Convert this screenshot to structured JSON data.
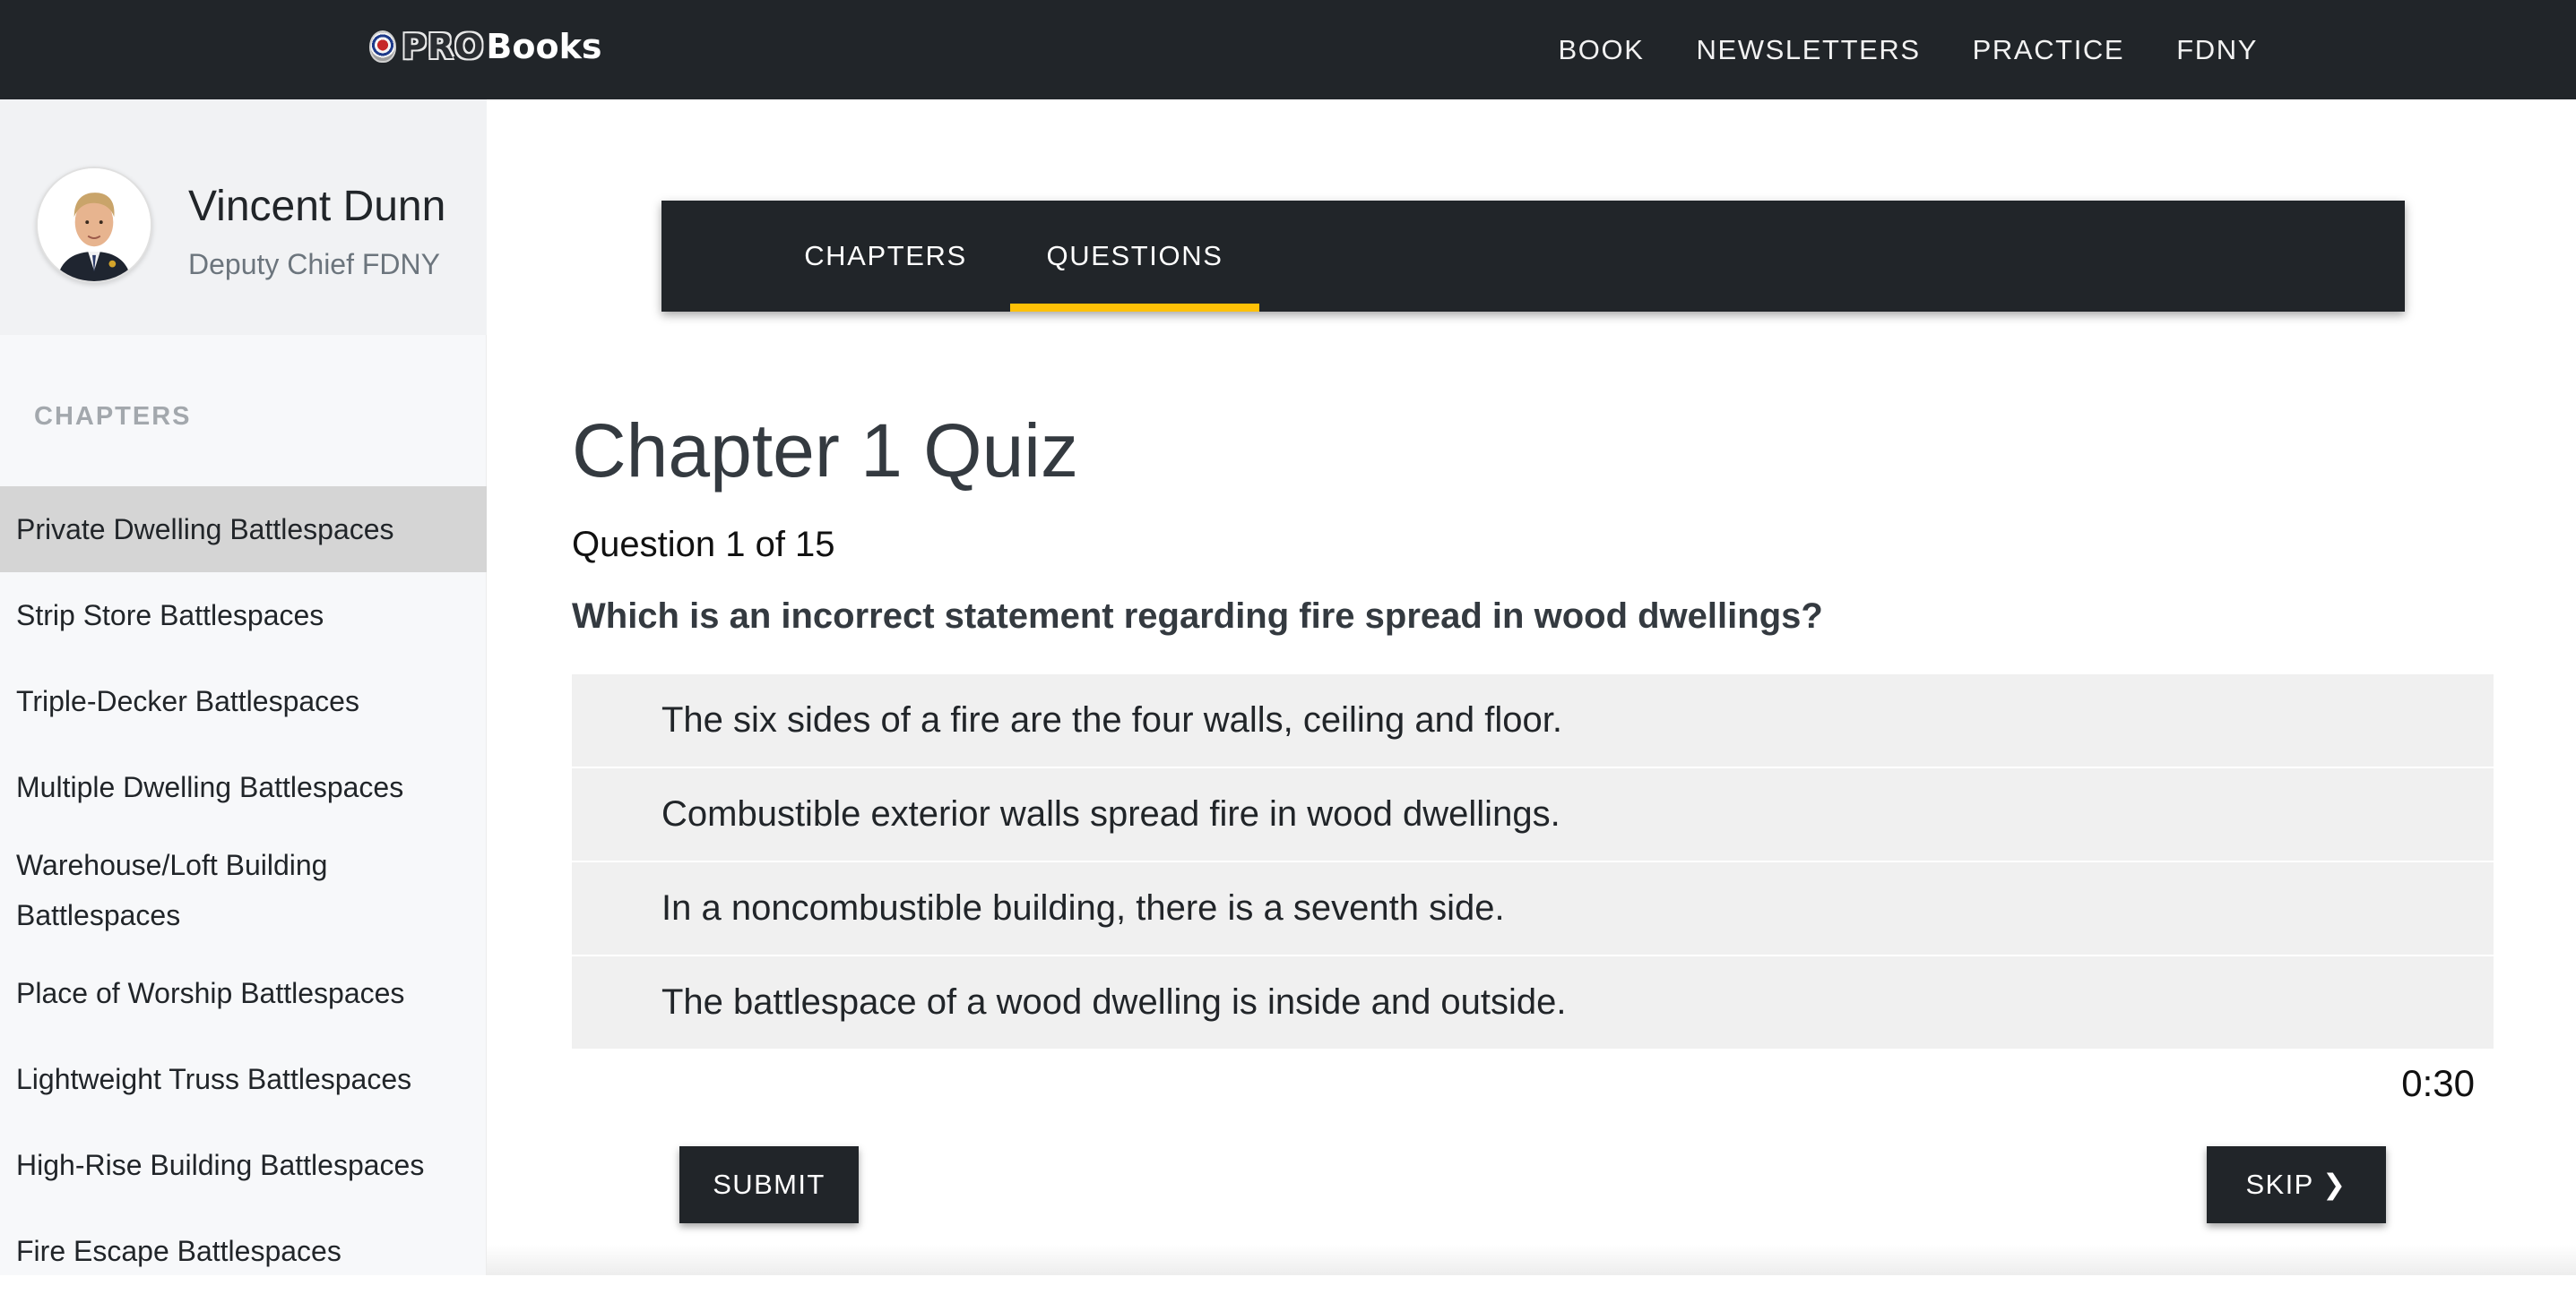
{
  "brand": {
    "pro": "PRO",
    "books": "Books"
  },
  "topnav": [
    {
      "label": "BOOK"
    },
    {
      "label": "NEWSLETTERS"
    },
    {
      "label": "PRACTICE"
    },
    {
      "label": "FDNY"
    }
  ],
  "profile": {
    "name": "Vincent Dunn",
    "title": "Deputy Chief FDNY"
  },
  "sidebar": {
    "heading": "CHAPTERS",
    "chapters": [
      {
        "label": "Private Dwelling Battlespaces",
        "active": true
      },
      {
        "label": "Strip Store Battlespaces"
      },
      {
        "label": "Triple-Decker Battlespaces"
      },
      {
        "label": "Multiple Dwelling Battlespaces"
      },
      {
        "label": "Warehouse/Loft Building Battlespaces"
      },
      {
        "label": "Place of Worship Battlespaces"
      },
      {
        "label": "Lightweight Truss Battlespaces"
      },
      {
        "label": "High-Rise Building Battlespaces"
      },
      {
        "label": "Fire Escape Battlespaces"
      }
    ]
  },
  "tabs": {
    "chapters": "CHAPTERS",
    "questions": "QUESTIONS",
    "active": "QUESTIONS"
  },
  "quiz": {
    "title": "Chapter 1 Quiz",
    "progress": "Question 1 of 15",
    "question": "Which is an incorrect statement regarding fire spread in wood dwellings?",
    "answers": [
      "The six sides of a fire are the four walls, ceiling and floor.",
      "Combustible exterior walls spread fire in wood dwellings.",
      "In a noncombustible building, there is a seventh side.",
      "The battlespace of a wood dwelling is inside and outside."
    ],
    "timer": "0:30",
    "submit_label": "SUBMIT",
    "skip_label": "SKIP ❯"
  },
  "colors": {
    "dark": "#212529",
    "accent": "#ffc107",
    "answer_bg": "#f0f0f0",
    "active_chapter": "#d5d5d5"
  }
}
